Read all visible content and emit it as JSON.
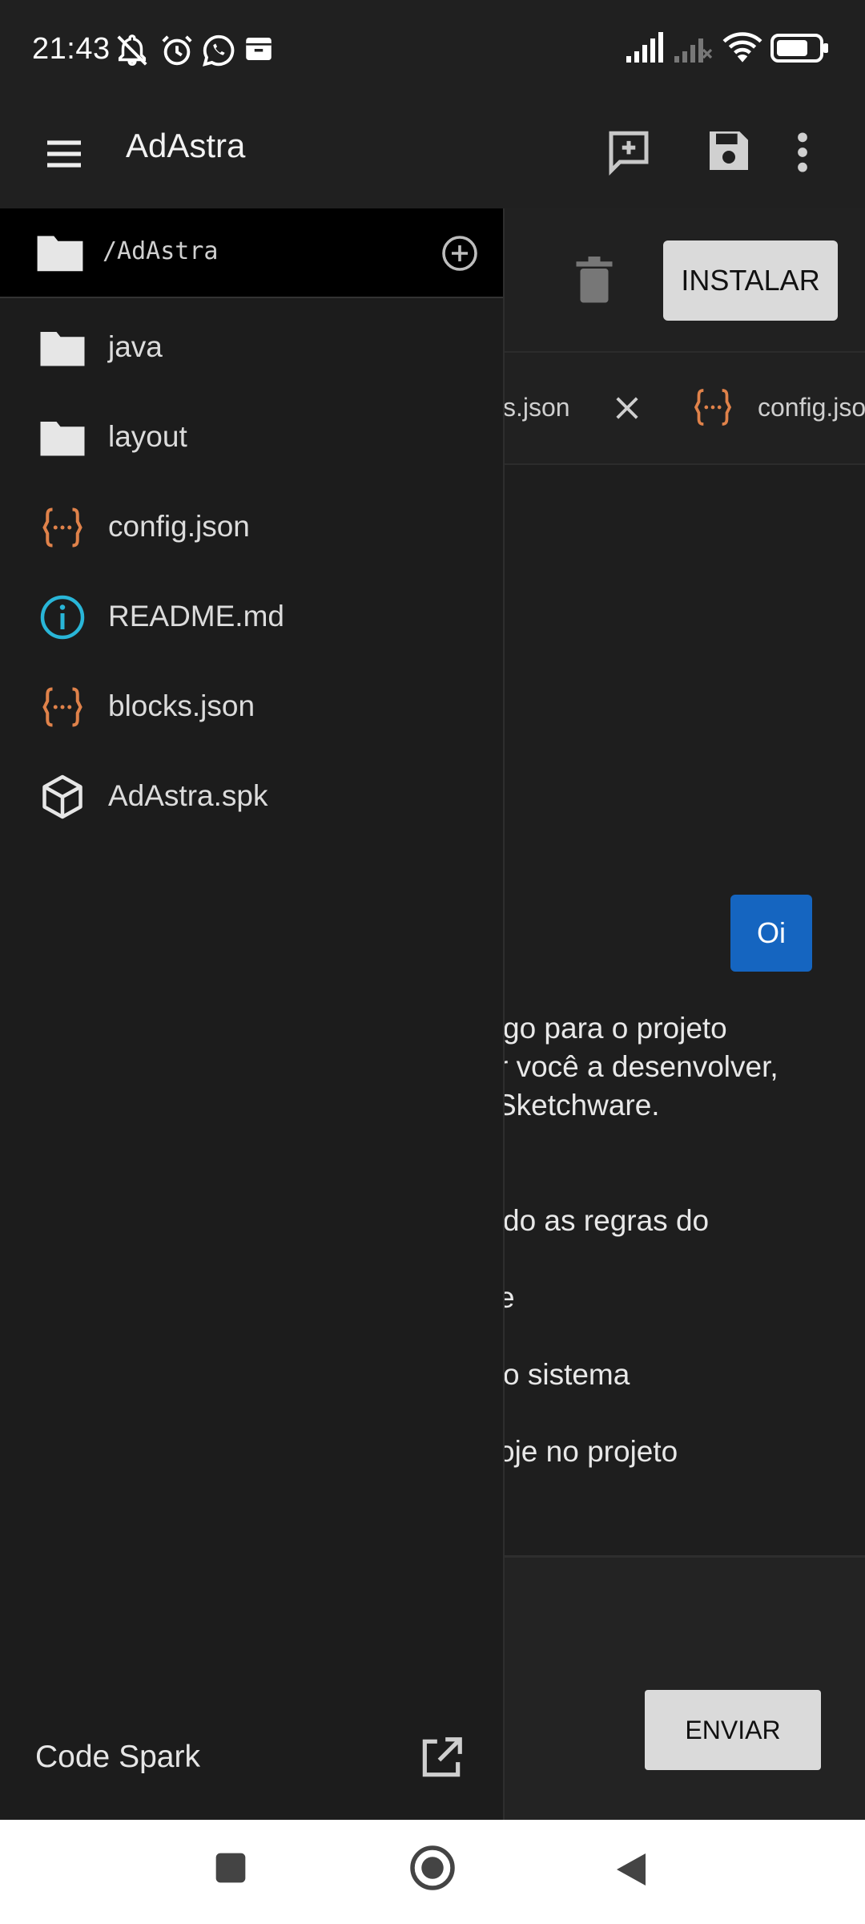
{
  "status_bar": {
    "time": "21:43",
    "icons_left": [
      "notifications-off-icon",
      "alarm-icon",
      "whatsapp-icon",
      "archive-icon"
    ],
    "icons_right": [
      "signal-icon",
      "signal-2-icon",
      "wifi-icon",
      "battery-icon"
    ]
  },
  "app_bar": {
    "title": "AdAstra",
    "actions": [
      "new-chat-icon",
      "save-icon",
      "more-vert-icon"
    ]
  },
  "toolbar": {
    "install_label": "INSTALAR"
  },
  "tabs": [
    {
      "label": "ks.json",
      "icon": "close-icon"
    },
    {
      "label": "config.jso",
      "icon": "json-icon"
    }
  ],
  "chat": {
    "user_message": "Oi",
    "assistant_lines": [
      "go para o projeto",
      "r você a desenvolver,",
      "Sketchware.",
      "do as regras do",
      "e",
      "o sistema",
      "oje no projeto"
    ],
    "send_label": "ENVIAR"
  },
  "drawer": {
    "path": "/AdAstra",
    "items": [
      {
        "label": "java",
        "icon": "folder-icon"
      },
      {
        "label": "layout",
        "icon": "folder-icon"
      },
      {
        "label": "config.json",
        "icon": "json-icon"
      },
      {
        "label": "README.md",
        "icon": "info-icon"
      },
      {
        "label": "blocks.json",
        "icon": "json-icon"
      },
      {
        "label": "AdAstra.spk",
        "icon": "package-icon"
      }
    ],
    "footer_label": "Code Spark"
  },
  "colors": {
    "background": "#1e1e1e",
    "accent_blue": "#1565c0",
    "json_orange": "#e0824a",
    "info_cyan": "#29b6d8",
    "button_gray": "#dadada"
  }
}
